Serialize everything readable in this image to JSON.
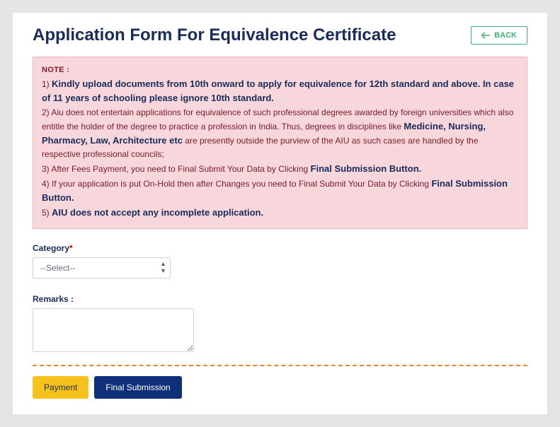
{
  "header": {
    "title": "Application Form For Equivalence Certificate",
    "back_label": "BACK"
  },
  "note": {
    "title": "NOTE :",
    "l1_num": "1) ",
    "l1_bold": "Kindly upload documents from 10th onward to apply for equivalence for 12th standard and above. In case of 11 years of schooling please ignore 10th standard.",
    "l2_a": "2) Aiu does not entertain applications for equivalence of such professional degrees awarded by foreign universities which also entitle the holder of the degree to practice a profession in India. Thus, degrees in disciplines like ",
    "l2_bold": "Medicine, Nursing, Pharmacy, Law, Architecture etc",
    "l2_b": " are presently outside the purview of the AIU as such cases are handled by the respective professional councils;",
    "l3_a": "3) After Fees Payment, you need to Final Submit Your Data by Clicking ",
    "l3_bold": "Final Submission Button.",
    "l4_a": "4) If your application is put On-Hold then after Changes you need to Final Submit Your Data by Clicking ",
    "l4_bold": "Final Submission Button.",
    "l5_num": "5) ",
    "l5_bold": "AIU does not accept any incomplete application."
  },
  "form": {
    "category_label": "Category",
    "category_selected": "--Select--",
    "remarks_label": "Remarks :",
    "remarks_value": ""
  },
  "buttons": {
    "payment": "Payment",
    "final_submission": "Final Submission"
  }
}
